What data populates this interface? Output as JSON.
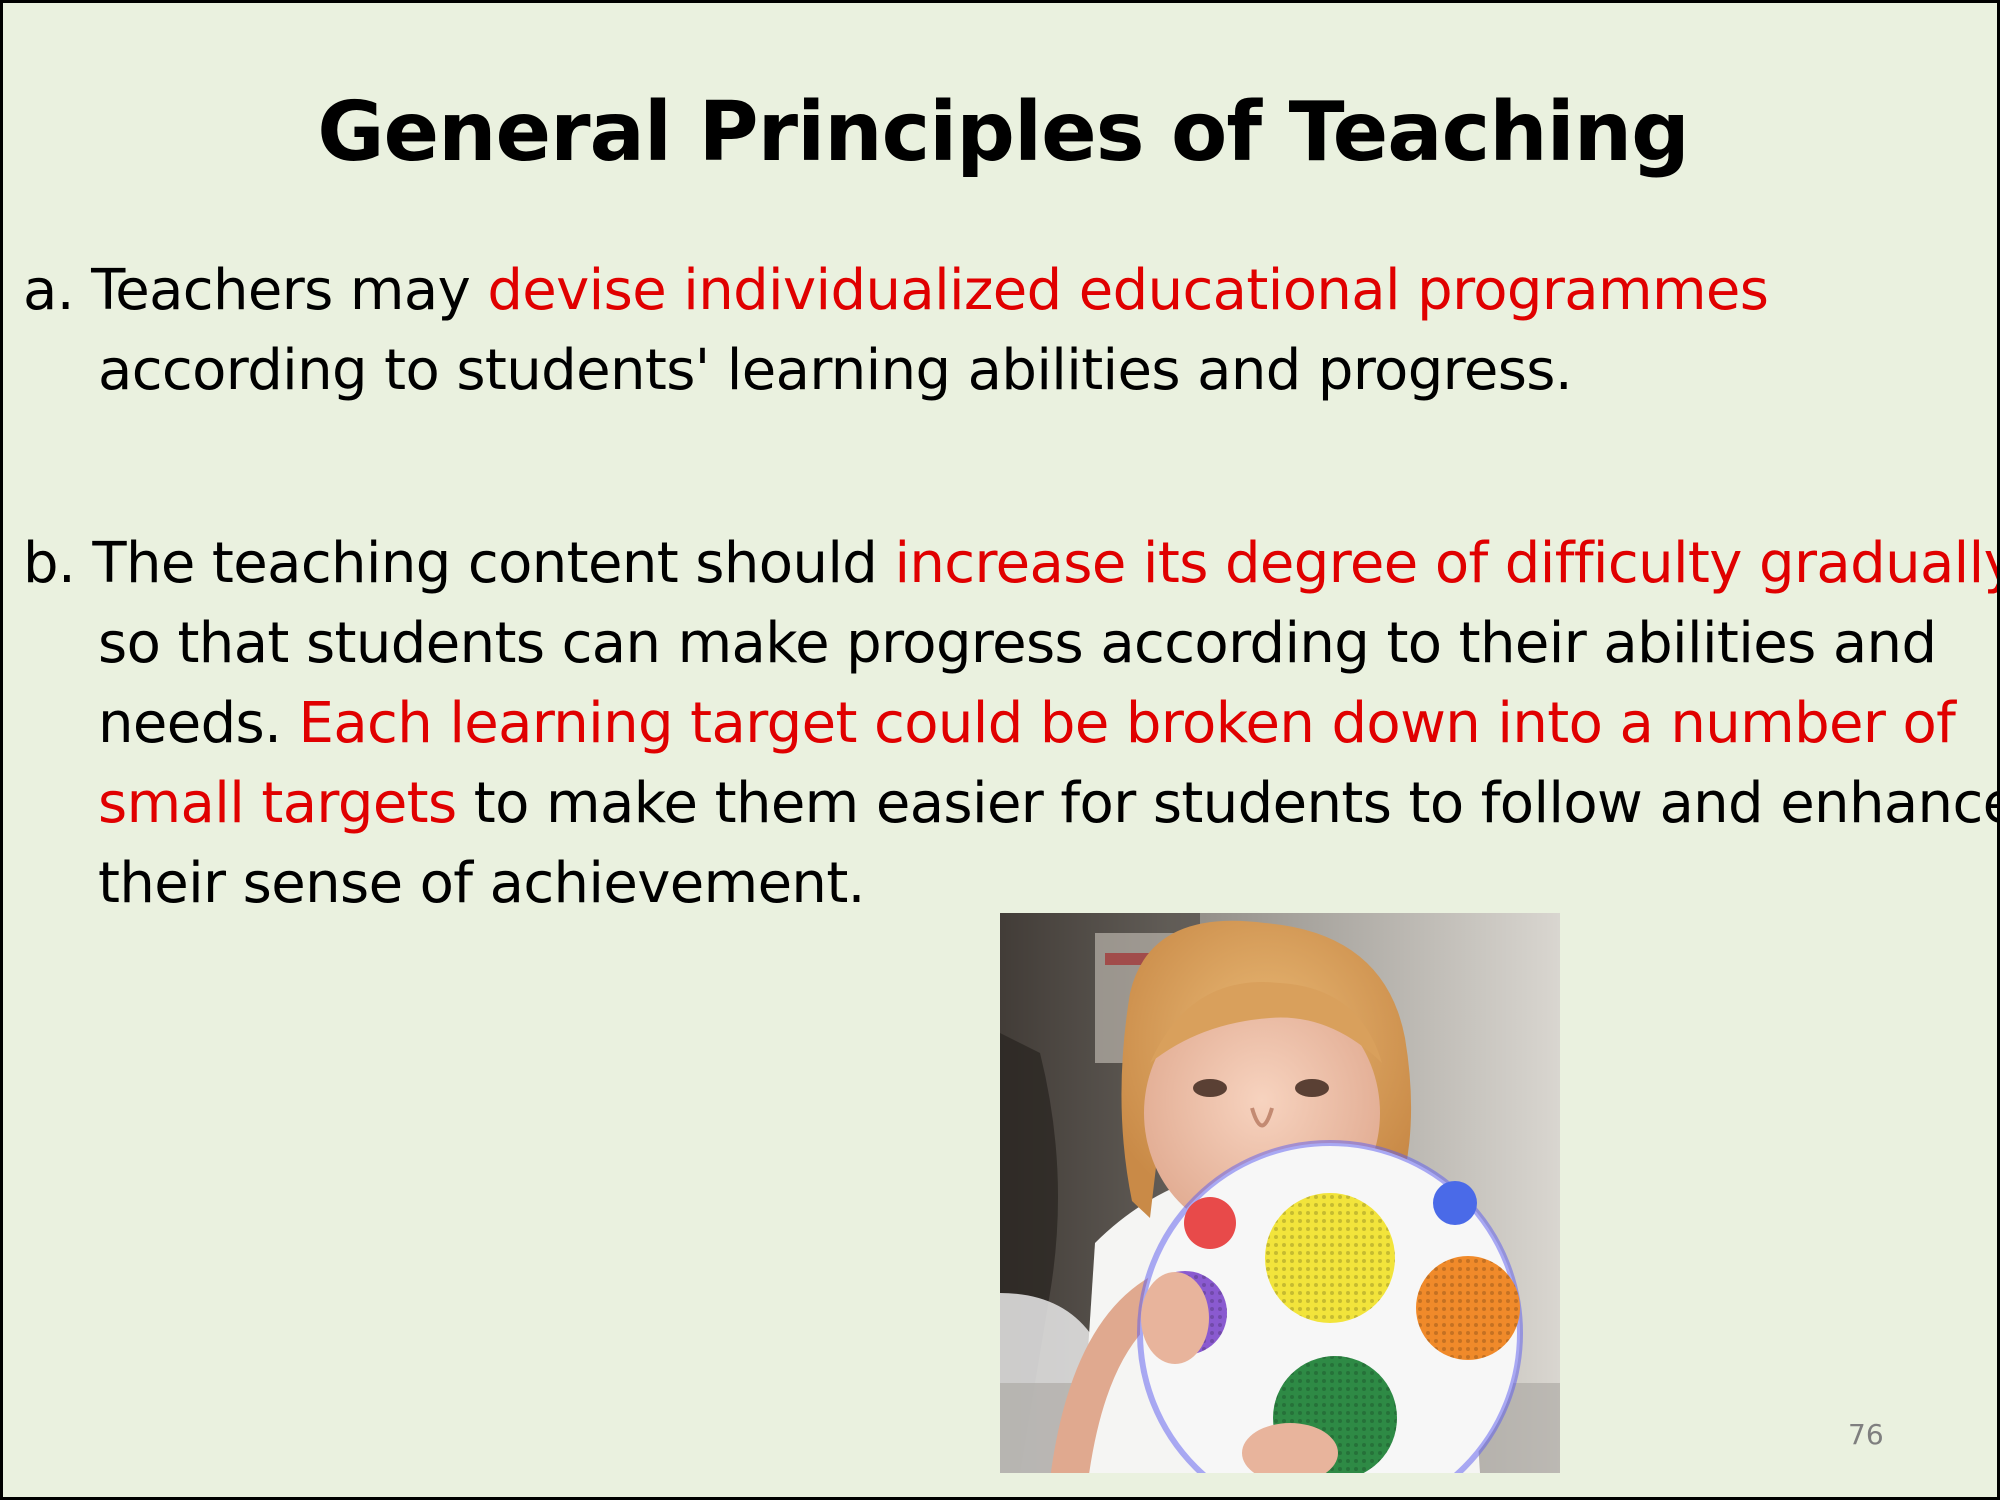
{
  "slide": {
    "title": "General Principles of Teaching",
    "page_number": "76",
    "colors": {
      "background": "#eaf1df",
      "text": "#000000",
      "highlight": "#e00000",
      "page_number": "#7f7f7f"
    },
    "points": {
      "a": {
        "prefix": "a. Teachers may ",
        "highlight": "devise individualized educational programmes",
        "line2": "according to students' learning abilities and progress."
      },
      "b": {
        "prefix": "b. The teaching content should ",
        "highlight1": "increase its degree of difficulty gradually",
        "comma": ",",
        "line2": "so that students can make progress according to their abilities and",
        "line3_prefix": "needs. ",
        "highlight2_part1": "Each learning target could be broken down into a number of",
        "highlight2_part2": "small targets",
        "line4_rest": " to make them easier for students to follow and enhance",
        "line5": "their sense of achievement."
      }
    },
    "photo": {
      "icon": "child-holding-ball-photo"
    }
  }
}
